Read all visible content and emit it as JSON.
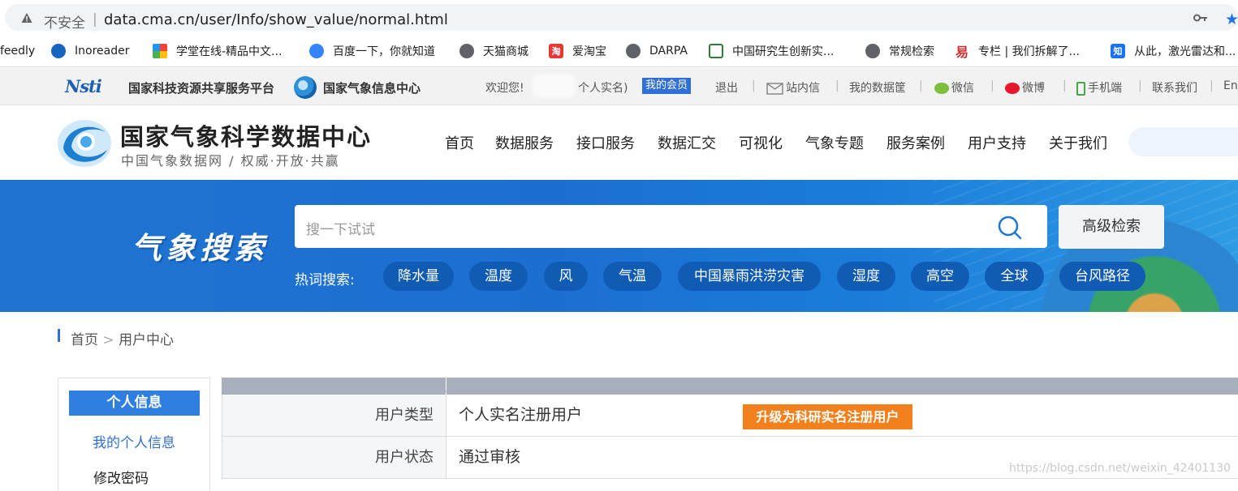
{
  "browser": {
    "insecure_label": "不安全",
    "separator": "|",
    "url": "data.cma.cn/user/Info/show_value/normal.html",
    "bookmarks": [
      {
        "label": "feedly"
      },
      {
        "label": "Inoreader",
        "icon": "inoreader-icon"
      },
      {
        "label": "学堂在线-精品中文...",
        "icon": "xuetang-icon"
      },
      {
        "label": "百度一下，你就知道",
        "icon": "baidu-icon"
      },
      {
        "label": "天猫商城",
        "icon": "globe-icon"
      },
      {
        "label": "爱淘宝",
        "icon": "aitaobao-icon",
        "icon_text": "淘"
      },
      {
        "label": "DARPA",
        "icon": "globe-icon"
      },
      {
        "label": "中国研究生创新实...",
        "icon": "innovation-icon"
      },
      {
        "label": "常规检索",
        "icon": "globe-icon"
      },
      {
        "label": "专栏 | 我们拆解了...",
        "icon": "zhuanlan-icon",
        "icon_text": "易"
      },
      {
        "label": "从此，激光雷达和...",
        "icon": "zhihu-icon",
        "icon_text": "知"
      }
    ]
  },
  "topbar": {
    "nstl_logo": "Nsti",
    "nstl_name": "国家科技资源共享服务平台",
    "cma_name": "国家气象信息中心",
    "welcome": "欢迎您!",
    "user_type": "个人实名)",
    "member": "我的会员",
    "logout": "退出",
    "messages": "站内信",
    "data_basket": "我的数据筐",
    "wechat": "微信",
    "weibo": "微博",
    "mobile": "手机端",
    "contact": "联系我们",
    "english": "En",
    "sep": "|"
  },
  "header": {
    "title": "国家气象科学数据中心",
    "subtitle": "中国气象数据网 / 权威·开放·共赢",
    "nav": [
      "首页",
      "数据服务",
      "接口服务",
      "数据汇交",
      "可视化",
      "气象专题",
      "服务案例",
      "用户支持",
      "关于我们"
    ]
  },
  "banner": {
    "title": "气象搜索",
    "search_placeholder": "搜一下试试",
    "advanced_search": "高级检索",
    "hot_label": "热词搜索:",
    "hot_terms": [
      "降水量",
      "温度",
      "风",
      "气温",
      "中国暴雨洪涝灾害",
      "湿度",
      "高空",
      "全球",
      "台风路径"
    ]
  },
  "breadcrumb": {
    "home": "首页",
    "sep": ">",
    "current": "用户中心"
  },
  "sidebar": {
    "heading": "个人信息",
    "items": [
      "我的个人信息",
      "修改密码"
    ]
  },
  "info_table": {
    "rows": [
      {
        "label": "用户类型",
        "value": "个人实名注册用户",
        "action": "升级为科研实名注册用户"
      },
      {
        "label": "用户状态",
        "value": "通过审核"
      }
    ]
  },
  "watermark": "https://blog.csdn.net/weixin_42401130",
  "colors": {
    "accent": "#2f6fd6",
    "banner": "#1c6fd1",
    "upgrade": "#f2811d",
    "hot_pill": "#105bb4"
  }
}
